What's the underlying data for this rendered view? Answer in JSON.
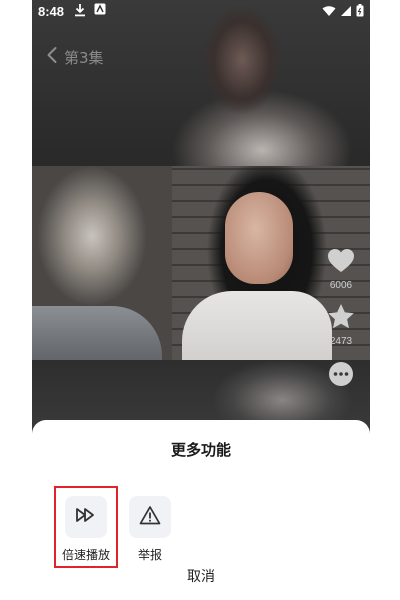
{
  "status_bar": {
    "time": "8:48",
    "left_icons": [
      "download-icon",
      "app-icon"
    ],
    "right_icons": [
      "wifi-icon",
      "signal-icon",
      "battery-icon"
    ]
  },
  "nav": {
    "back_icon": "chevron-left-icon",
    "title": "第3集"
  },
  "side_actions": [
    {
      "icon": "heart-icon",
      "count": "6006"
    },
    {
      "icon": "star-icon",
      "count": "2473"
    },
    {
      "icon": "more-icon",
      "count": ""
    }
  ],
  "sheet": {
    "title": "更多功能",
    "options": [
      {
        "icon": "double-play-icon",
        "label": "倍速播放"
      },
      {
        "icon": "warning-icon",
        "label": "举报"
      }
    ],
    "cancel_label": "取消"
  },
  "colors": {
    "highlight": "#e1232b",
    "sheet_background": "#ffffff",
    "option_background": "#f1f2f5"
  }
}
